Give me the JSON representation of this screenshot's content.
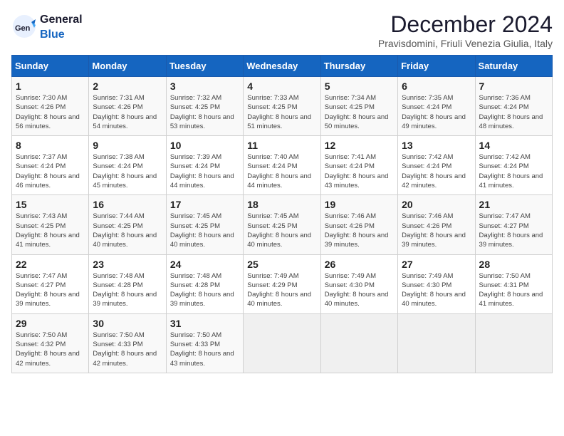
{
  "header": {
    "logo_general": "General",
    "logo_blue": "Blue",
    "month_title": "December 2024",
    "location": "Pravisdomini, Friuli Venezia Giulia, Italy"
  },
  "calendar": {
    "headers": [
      "Sunday",
      "Monday",
      "Tuesday",
      "Wednesday",
      "Thursday",
      "Friday",
      "Saturday"
    ],
    "weeks": [
      [
        null,
        null,
        null,
        {
          "day": "4",
          "sunrise": "7:33 AM",
          "sunset": "4:25 PM",
          "daylight": "8 hours and 51 minutes."
        },
        {
          "day": "5",
          "sunrise": "7:34 AM",
          "sunset": "4:25 PM",
          "daylight": "8 hours and 50 minutes."
        },
        {
          "day": "6",
          "sunrise": "7:35 AM",
          "sunset": "4:24 PM",
          "daylight": "8 hours and 49 minutes."
        },
        {
          "day": "7",
          "sunrise": "7:36 AM",
          "sunset": "4:24 PM",
          "daylight": "8 hours and 48 minutes."
        }
      ],
      [
        {
          "day": "1",
          "sunrise": "7:30 AM",
          "sunset": "4:26 PM",
          "daylight": "8 hours and 56 minutes."
        },
        {
          "day": "2",
          "sunrise": "7:31 AM",
          "sunset": "4:26 PM",
          "daylight": "8 hours and 54 minutes."
        },
        {
          "day": "3",
          "sunrise": "7:32 AM",
          "sunset": "4:25 PM",
          "daylight": "8 hours and 53 minutes."
        },
        {
          "day": "4",
          "sunrise": "7:33 AM",
          "sunset": "4:25 PM",
          "daylight": "8 hours and 51 minutes."
        },
        {
          "day": "5",
          "sunrise": "7:34 AM",
          "sunset": "4:25 PM",
          "daylight": "8 hours and 50 minutes."
        },
        {
          "day": "6",
          "sunrise": "7:35 AM",
          "sunset": "4:24 PM",
          "daylight": "8 hours and 49 minutes."
        },
        {
          "day": "7",
          "sunrise": "7:36 AM",
          "sunset": "4:24 PM",
          "daylight": "8 hours and 48 minutes."
        }
      ],
      [
        {
          "day": "8",
          "sunrise": "7:37 AM",
          "sunset": "4:24 PM",
          "daylight": "8 hours and 46 minutes."
        },
        {
          "day": "9",
          "sunrise": "7:38 AM",
          "sunset": "4:24 PM",
          "daylight": "8 hours and 45 minutes."
        },
        {
          "day": "10",
          "sunrise": "7:39 AM",
          "sunset": "4:24 PM",
          "daylight": "8 hours and 44 minutes."
        },
        {
          "day": "11",
          "sunrise": "7:40 AM",
          "sunset": "4:24 PM",
          "daylight": "8 hours and 44 minutes."
        },
        {
          "day": "12",
          "sunrise": "7:41 AM",
          "sunset": "4:24 PM",
          "daylight": "8 hours and 43 minutes."
        },
        {
          "day": "13",
          "sunrise": "7:42 AM",
          "sunset": "4:24 PM",
          "daylight": "8 hours and 42 minutes."
        },
        {
          "day": "14",
          "sunrise": "7:42 AM",
          "sunset": "4:24 PM",
          "daylight": "8 hours and 41 minutes."
        }
      ],
      [
        {
          "day": "15",
          "sunrise": "7:43 AM",
          "sunset": "4:25 PM",
          "daylight": "8 hours and 41 minutes."
        },
        {
          "day": "16",
          "sunrise": "7:44 AM",
          "sunset": "4:25 PM",
          "daylight": "8 hours and 40 minutes."
        },
        {
          "day": "17",
          "sunrise": "7:45 AM",
          "sunset": "4:25 PM",
          "daylight": "8 hours and 40 minutes."
        },
        {
          "day": "18",
          "sunrise": "7:45 AM",
          "sunset": "4:25 PM",
          "daylight": "8 hours and 40 minutes."
        },
        {
          "day": "19",
          "sunrise": "7:46 AM",
          "sunset": "4:26 PM",
          "daylight": "8 hours and 39 minutes."
        },
        {
          "day": "20",
          "sunrise": "7:46 AM",
          "sunset": "4:26 PM",
          "daylight": "8 hours and 39 minutes."
        },
        {
          "day": "21",
          "sunrise": "7:47 AM",
          "sunset": "4:27 PM",
          "daylight": "8 hours and 39 minutes."
        }
      ],
      [
        {
          "day": "22",
          "sunrise": "7:47 AM",
          "sunset": "4:27 PM",
          "daylight": "8 hours and 39 minutes."
        },
        {
          "day": "23",
          "sunrise": "7:48 AM",
          "sunset": "4:28 PM",
          "daylight": "8 hours and 39 minutes."
        },
        {
          "day": "24",
          "sunrise": "7:48 AM",
          "sunset": "4:28 PM",
          "daylight": "8 hours and 39 minutes."
        },
        {
          "day": "25",
          "sunrise": "7:49 AM",
          "sunset": "4:29 PM",
          "daylight": "8 hours and 40 minutes."
        },
        {
          "day": "26",
          "sunrise": "7:49 AM",
          "sunset": "4:30 PM",
          "daylight": "8 hours and 40 minutes."
        },
        {
          "day": "27",
          "sunrise": "7:49 AM",
          "sunset": "4:30 PM",
          "daylight": "8 hours and 40 minutes."
        },
        {
          "day": "28",
          "sunrise": "7:50 AM",
          "sunset": "4:31 PM",
          "daylight": "8 hours and 41 minutes."
        }
      ],
      [
        {
          "day": "29",
          "sunrise": "7:50 AM",
          "sunset": "4:32 PM",
          "daylight": "8 hours and 42 minutes."
        },
        {
          "day": "30",
          "sunrise": "7:50 AM",
          "sunset": "4:33 PM",
          "daylight": "8 hours and 42 minutes."
        },
        {
          "day": "31",
          "sunrise": "7:50 AM",
          "sunset": "4:33 PM",
          "daylight": "8 hours and 43 minutes."
        },
        null,
        null,
        null,
        null
      ]
    ]
  },
  "labels": {
    "sunrise_prefix": "Sunrise: ",
    "sunset_prefix": "Sunset: ",
    "daylight_prefix": "Daylight: "
  }
}
